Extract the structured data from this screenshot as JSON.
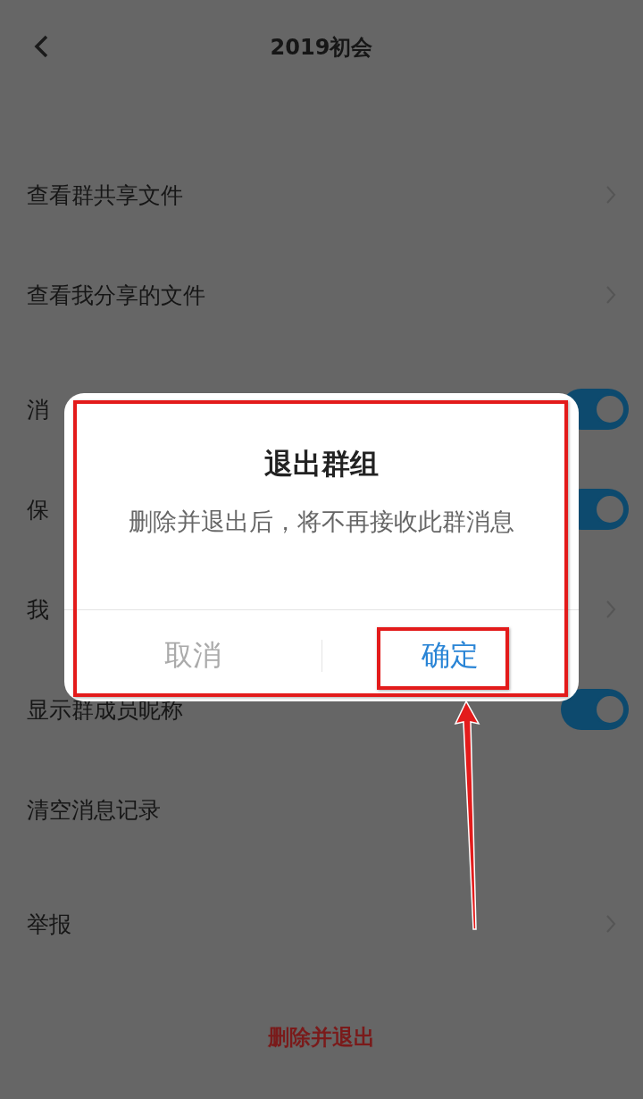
{
  "header": {
    "title": "2019初会"
  },
  "sections": [
    {
      "rows": [
        {
          "kind": "link",
          "label": "查看群共享文件"
        },
        {
          "kind": "link",
          "label": "查看我分享的文件"
        }
      ]
    },
    {
      "rows": [
        {
          "kind": "toggle",
          "label": "消",
          "on": true
        },
        {
          "kind": "toggle",
          "label": "保",
          "on": true
        },
        {
          "kind": "link",
          "label": "我"
        },
        {
          "kind": "toggle",
          "label": "显示群成员昵称",
          "on": true
        },
        {
          "kind": "plain",
          "label": "清空消息记录"
        }
      ]
    },
    {
      "rows": [
        {
          "kind": "link",
          "label": "举报"
        }
      ]
    }
  ],
  "delete_button": "删除并退出",
  "dialog": {
    "title": "退出群组",
    "message": "删除并退出后，将不再接收此群消息",
    "buttons": [
      {
        "label": "取消",
        "kind": "cancel"
      },
      {
        "label": "确定",
        "kind": "confirm"
      }
    ]
  },
  "annotations": [
    {
      "kind": "dialog_box"
    },
    {
      "kind": "button_box"
    },
    {
      "kind": "arrow"
    }
  ]
}
